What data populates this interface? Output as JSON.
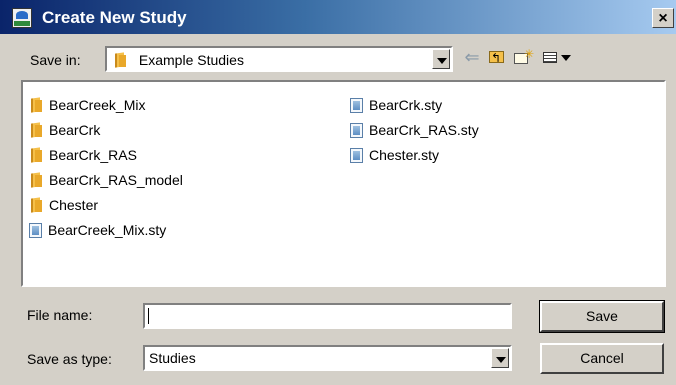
{
  "window": {
    "title": "Create New Study",
    "close_glyph": "×"
  },
  "toolbar": {
    "save_in_label": "Save in:",
    "location": "Example Studies",
    "back_icon": "back-arrow-icon",
    "up_icon": "up-one-level-icon",
    "new_folder_icon": "new-folder-icon",
    "view_menu_icon": "view-menu-icon"
  },
  "files": {
    "column1": [
      {
        "name": "BearCreek_Mix",
        "type": "folder"
      },
      {
        "name": "BearCrk",
        "type": "folder"
      },
      {
        "name": "BearCrk_RAS",
        "type": "folder"
      },
      {
        "name": "BearCrk_RAS_model",
        "type": "folder"
      },
      {
        "name": "Chester",
        "type": "folder"
      },
      {
        "name": "BearCreek_Mix.sty",
        "type": "file"
      }
    ],
    "column2": [
      {
        "name": "BearCrk.sty",
        "type": "file"
      },
      {
        "name": "BearCrk_RAS.sty",
        "type": "file"
      },
      {
        "name": "Chester.sty",
        "type": "file"
      }
    ]
  },
  "form": {
    "filename_label": "File name:",
    "filename_value": "",
    "type_label": "Save as type:",
    "type_value": "Studies"
  },
  "buttons": {
    "save": "Save",
    "cancel": "Cancel"
  },
  "colors": {
    "titlebar_start": "#0a246a",
    "titlebar_end": "#a6caf0",
    "dialog_face": "#d4d0c8",
    "folder": "#f5c04a"
  }
}
